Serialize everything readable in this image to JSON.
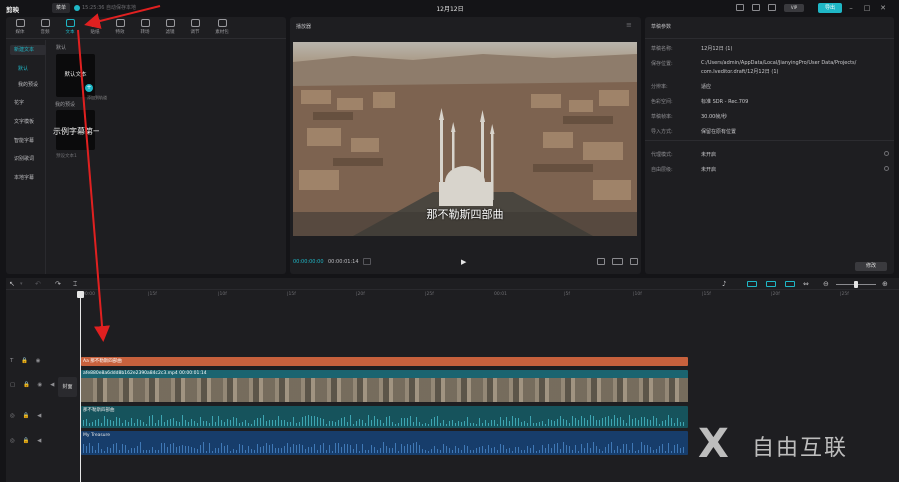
{
  "titlebar": {
    "app_name": "剪映",
    "menu_label": "菜单",
    "autosave": "15:25:36 自动保存本地",
    "doc_title": "12月12日",
    "pro_badge": "VIP",
    "export_label": "导出"
  },
  "media_tools": [
    {
      "label": "媒体",
      "icon": "media-icon"
    },
    {
      "label": "音频",
      "icon": "audio-icon"
    },
    {
      "label": "文本",
      "icon": "text-icon",
      "active": true
    },
    {
      "label": "贴纸",
      "icon": "sticker-icon"
    },
    {
      "label": "特效",
      "icon": "effects-icon"
    },
    {
      "label": "转场",
      "icon": "transition-icon"
    },
    {
      "label": "滤镜",
      "icon": "filter-icon"
    },
    {
      "label": "调节",
      "icon": "adjust-icon"
    },
    {
      "label": "素材包",
      "icon": "package-icon"
    }
  ],
  "text_menu": [
    {
      "label": "新建文本",
      "active": true
    },
    {
      "label": "默认"
    },
    {
      "label": "我的预设"
    },
    {
      "label": "花字"
    },
    {
      "label": "文字模板"
    },
    {
      "label": "智能字幕"
    },
    {
      "label": "识别歌词"
    },
    {
      "label": "本地字幕"
    }
  ],
  "text_panel": {
    "section_default": "默认",
    "card_default_label": "默认文本",
    "tooltip": "添加到轨道",
    "section_mine": "我的预设",
    "card_preset_text": "示例字幕第一",
    "card_preset_caption": "预设文本1"
  },
  "player": {
    "title": "播放器",
    "subtitle": "那不勒斯四部曲",
    "time_current": "00:00:00:00",
    "time_total": "00:00:01:14"
  },
  "draft": {
    "title": "草稿参数",
    "rows": [
      {
        "key": "草稿名称:",
        "value": "12月12日 (1)"
      },
      {
        "key": "保存位置:",
        "value": "C:/Users/admin/AppData/Local/JianyingPro/User Data/Projects/"
      },
      {
        "key": "",
        "value": "com.lveditor.draft/12月12日 (1)"
      },
      {
        "key": "分辨率:",
        "value": "适应"
      },
      {
        "key": "色彩空间:",
        "value": "标准 SDR - Rec.709"
      },
      {
        "key": "草稿帧率:",
        "value": "30.00帧/秒"
      },
      {
        "key": "导入方式:",
        "value": "保留在原有位置"
      }
    ],
    "rows2": [
      {
        "key": "代理模式:",
        "value": "未开启"
      },
      {
        "key": "自由层级:",
        "value": "未开启"
      }
    ],
    "edit_label": "修改"
  },
  "timeline": {
    "ticks": [
      "00:00",
      "|15f",
      "|10f",
      "|15f",
      "|20f",
      "|25f",
      "00:01",
      "|5f",
      "|10f",
      "|15f",
      "|20f",
      "|25f"
    ],
    "cover_label": "封面",
    "text_clip": "Aa 那不勒斯四部曲",
    "video_clip": "afe880e8a6ddd8b162e2390a84c2c3.mp4   00:00:01:14",
    "audio_clip1": "那不勒斯四部曲",
    "audio_clip2": "My Treasure"
  },
  "watermark": {
    "mark": "X",
    "text": "自由互联"
  },
  "colors": {
    "accent": "#1fb7c6",
    "text_clip": "#c7613d",
    "video_clip": "#1b6470",
    "audio_clip1": "#16535c",
    "audio_clip2": "#173d6b",
    "annotation_arrow": "#e02020"
  }
}
